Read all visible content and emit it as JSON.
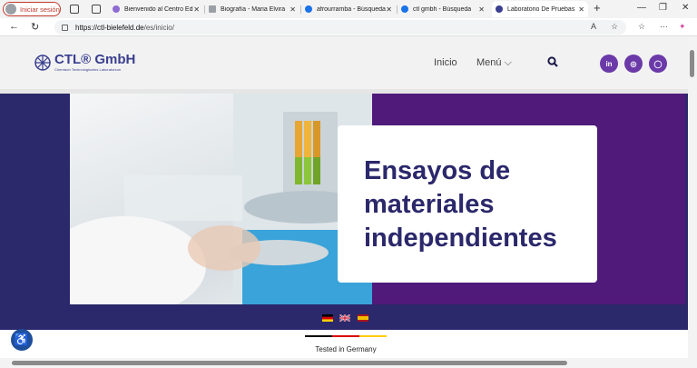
{
  "browser": {
    "profile_label": "Iniciar sesión",
    "tabs": [
      {
        "title": "Bienvenido al Centro Ed",
        "icon": "globe-icon",
        "color": "#8e6bd1"
      },
      {
        "title": "Biografía - Maria Elvira",
        "icon": "page-icon",
        "color": "#9aa0a6"
      },
      {
        "title": "afrourramba - Búsqueda",
        "icon": "search-icon",
        "color": "#1a73e8"
      },
      {
        "title": "ctl gmbh - Búsqueda",
        "icon": "search-icon",
        "color": "#1a73e8"
      },
      {
        "title": "Laboratorio De Pruebas",
        "icon": "ctl-favicon",
        "color": "#3a3f8f"
      }
    ],
    "url_host": "https://ctl-bielefeld.de",
    "url_path": "/es/inicio/"
  },
  "site": {
    "logo_name": "CTL® GmbH",
    "logo_sub": "Chemisch Technologisches Laboratorium",
    "nav": {
      "home": "Inicio",
      "menu": "Menú ⌵"
    },
    "social": [
      "in",
      "◎",
      "◯"
    ],
    "hero_title_lines": [
      "Ensayos de",
      "materiales",
      "independientes"
    ],
    "tested_label": "Tested in Germany"
  },
  "colors": {
    "brand_dark": "#2b286b",
    "brand_purple": "#4f1a7a",
    "social": "#6b3aa8"
  }
}
